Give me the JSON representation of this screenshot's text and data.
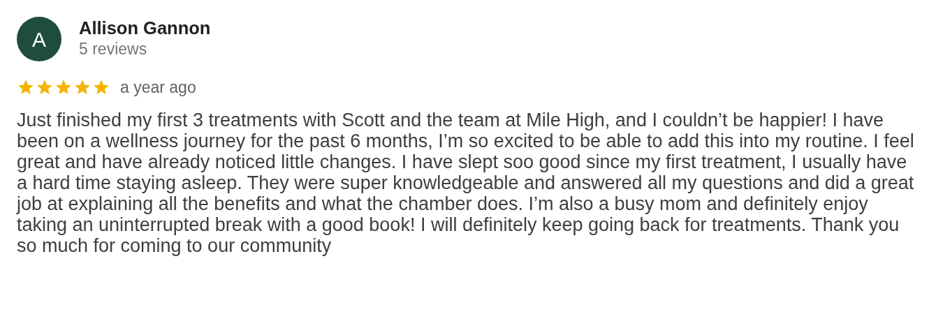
{
  "reviewer": {
    "avatar_letter": "A",
    "name": "Allison Gannon",
    "review_count": "5 reviews"
  },
  "review": {
    "stars": 5,
    "time": "a year ago",
    "text": "Just finished my first 3 treatments with Scott and the team at Mile High, and I couldn’t be happier! I have been on a wellness journey for the past 6 months, I’m so excited to be able to add this into my routine. I feel great and have already noticed little changes. I have slept soo good since my first treatment, I usually have a hard time staying asleep. They were super knowledgeable and answered all my questions and did a great job at explaining all the benefits and what the chamber does. I’m also a busy mom and definitely enjoy taking an uninterrupted break with a good book! I will definitely keep going back for treatments. Thank you so much for coming to our community"
  }
}
